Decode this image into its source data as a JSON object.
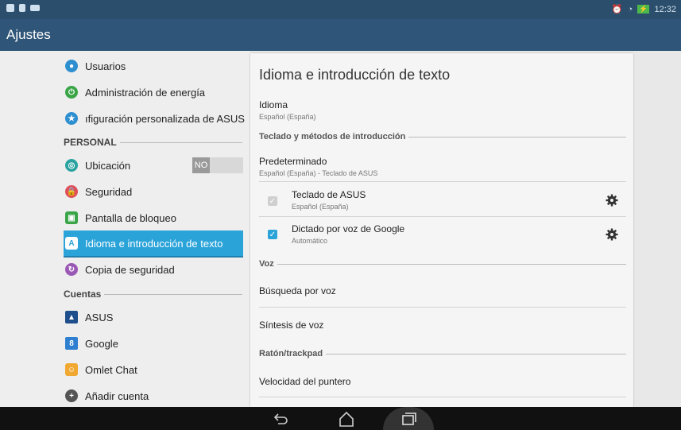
{
  "status": {
    "time": "12:32"
  },
  "app_title": "Ajustes",
  "left": {
    "items_top": [
      {
        "label": "Usuarios",
        "icon": "user-icon",
        "color": "#2e8fd0"
      },
      {
        "label": "Administración de energía",
        "icon": "power-icon",
        "color": "#3aa547"
      },
      {
        "label": "ıfiguración personalizada de ASUS",
        "icon": "asus-custom-icon",
        "color": "#2e8fd0"
      }
    ],
    "personal_header": "PERSONAL",
    "items_personal": [
      {
        "label": "Ubicación",
        "icon": "location-icon",
        "color": "#2aa3a0"
      },
      {
        "label": "Seguridad",
        "icon": "lock-icon",
        "color": "#e0505a"
      },
      {
        "label": "Pantalla de bloqueo",
        "icon": "lockscreen-icon",
        "color": "#3aa547"
      },
      {
        "label": "Idioma e introducción de texto",
        "icon": "language-icon",
        "color": "#2aa3d9"
      },
      {
        "label": "Copia de seguridad",
        "icon": "backup-icon",
        "color": "#9b59b6"
      }
    ],
    "location_toggle": "NO",
    "cuentas_header": "Cuentas",
    "items_accounts": [
      {
        "label": "ASUS",
        "icon": "asus-account-icon",
        "color": "#1e4f8c"
      },
      {
        "label": "Google",
        "icon": "google-icon",
        "color": "#2e7fd0"
      },
      {
        "label": "Omlet Chat",
        "icon": "omlet-icon",
        "color": "#f0a830"
      },
      {
        "label": "Añadir cuenta",
        "icon": "add-account-icon",
        "color": "#555555"
      }
    ]
  },
  "right": {
    "title": "Idioma e introducción de texto",
    "idioma_label": "Idioma",
    "idioma_value": "Español (España)",
    "keyboard_section": "Teclado y métodos de introducción",
    "default_label": "Predeterminado",
    "default_value": "Español (España) - Teclado de ASUS",
    "asus_kbd_label": "Teclado de ASUS",
    "asus_kbd_sub": "Español (España)",
    "google_voice_label": "Dictado por voz de Google",
    "google_voice_sub": "Automático",
    "voz_section": "Voz",
    "voice_search": "Búsqueda por voz",
    "tts": "Síntesis de voz",
    "mouse_section": "Ratón/trackpad",
    "pointer_speed": "Velocidad del puntero"
  },
  "colors": {
    "accent": "#2aa3d9",
    "actionbar": "#2f5578",
    "statusbar": "#2b4e6c"
  }
}
